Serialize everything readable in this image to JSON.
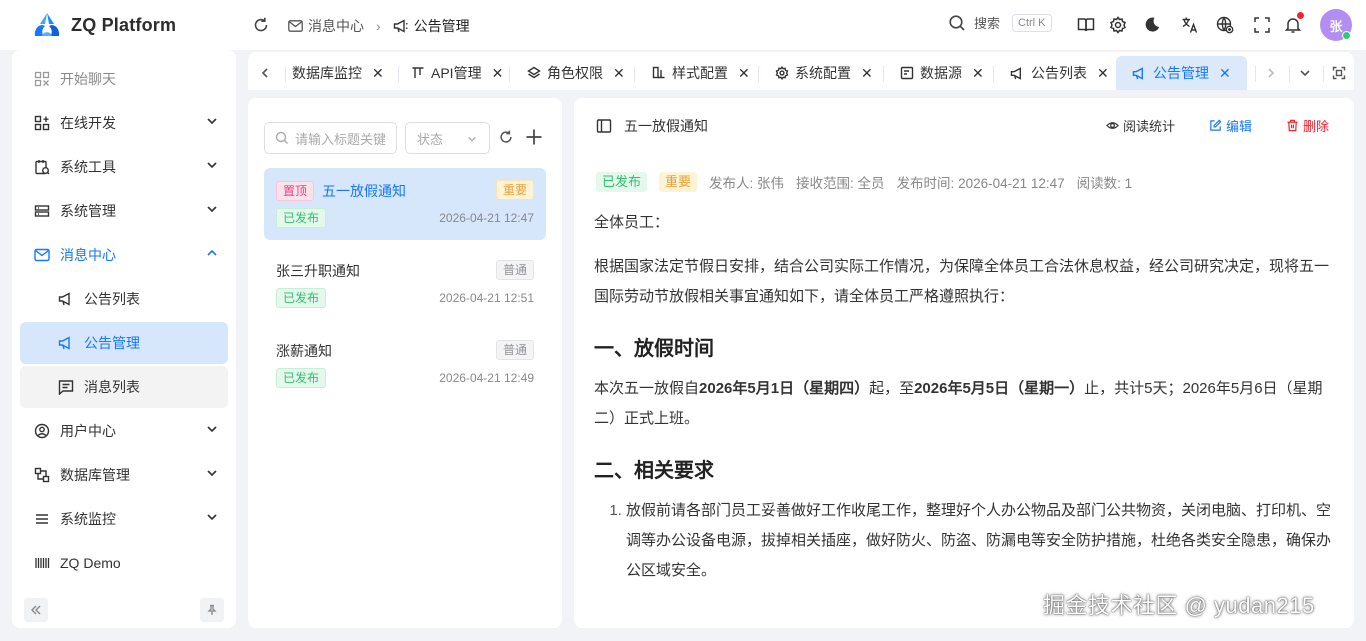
{
  "app": {
    "title": "ZQ Platform",
    "brand_color": "#1677ff"
  },
  "header": {
    "breadcrumb": [
      "消息中心",
      "公告管理"
    ],
    "search_label": "搜索",
    "search_shortcut": "Ctrl K",
    "avatar_text": "张",
    "icons": [
      "refresh-icon",
      "book-icon",
      "settings-icon",
      "moon-icon",
      "translate-icon",
      "globe-icon",
      "fullscreen-icon",
      "bell-icon"
    ]
  },
  "sidebar": {
    "items": [
      {
        "label": "开始聊天",
        "icon": "chat-icon"
      },
      {
        "label": "在线开发",
        "icon": "dev-icon"
      },
      {
        "label": "系统工具",
        "icon": "tool-icon"
      },
      {
        "label": "系统管理",
        "icon": "system-icon"
      },
      {
        "label": "消息中心",
        "icon": "mail-icon"
      },
      {
        "label": "公告列表",
        "icon": "megaphone-icon"
      },
      {
        "label": "公告管理",
        "icon": "megaphone-icon"
      },
      {
        "label": "消息列表",
        "icon": "message-list-icon"
      },
      {
        "label": "用户中心",
        "icon": "user-icon"
      },
      {
        "label": "数据库管理",
        "icon": "database-icon"
      },
      {
        "label": "系统监控",
        "icon": "monitor-icon"
      },
      {
        "label": "ZQ Demo",
        "icon": "barcode-icon"
      }
    ]
  },
  "tabs": [
    {
      "label": "数据库监控",
      "icon": "monitor-icon"
    },
    {
      "label": "API管理",
      "icon": "api-icon"
    },
    {
      "label": "角色权限",
      "icon": "role-icon"
    },
    {
      "label": "样式配置",
      "icon": "style-icon"
    },
    {
      "label": "系统配置",
      "icon": "gear-icon"
    },
    {
      "label": "数据源",
      "icon": "datasource-icon"
    },
    {
      "label": "公告列表",
      "icon": "megaphone-icon"
    },
    {
      "label": "公告管理",
      "icon": "megaphone-icon",
      "active": true
    }
  ],
  "list": {
    "search_placeholder": "请输入标题关键",
    "status_placeholder": "状态",
    "notices": [
      {
        "pinned": "置顶",
        "title": "五一放假通知",
        "level": "重要",
        "status": "已发布",
        "time": "2026-04-21 12:47",
        "selected": true
      },
      {
        "title": "张三升职通知",
        "level": "普通",
        "status": "已发布",
        "time": "2026-04-21 12:51"
      },
      {
        "title": "涨薪通知",
        "level": "普通",
        "status": "已发布",
        "time": "2026-04-21 12:49"
      }
    ]
  },
  "detail": {
    "title": "五一放假通知",
    "actions": {
      "stats": "阅读统计",
      "edit": "编辑",
      "delete": "删除"
    },
    "meta": {
      "status": "已发布",
      "level": "重要",
      "publisher": "发布人: 张伟",
      "scope": "接收范围: 全员",
      "publish_time": "发布时间: 2026-04-21 12:47",
      "reads": "阅读数: 1"
    },
    "greeting": "全体员工：",
    "intro": "根据国家法定节假日安排，结合公司实际工作情况，为保障全体员工合法休息权益，经公司研究决定，现将五一国际劳动节放假相关事宜通知如下，请全体员工严格遵照执行：",
    "section1_title": "一、放假时间",
    "section1": {
      "p1": "本次五一放假自",
      "b1": "2026年5月1日（星期四）",
      "p2": "起，至",
      "b2": "2026年5月5日（星期一）",
      "p3": "止，共计5天；2026年5月6日（星期二）正式上班。"
    },
    "section2_title": "二、相关要求",
    "section2_items": [
      "放假前请各部门员工妥善做好工作收尾工作，整理好个人办公物品及部门公共物资，关闭电脑、打印机、空调等办公设备电源，拔掉相关插座，做好防火、防盗、防漏电等安全防护措施，杜绝各类安全隐患，确保办公区域安全。"
    ]
  },
  "watermark": "掘金技术社区 @ yudan215"
}
